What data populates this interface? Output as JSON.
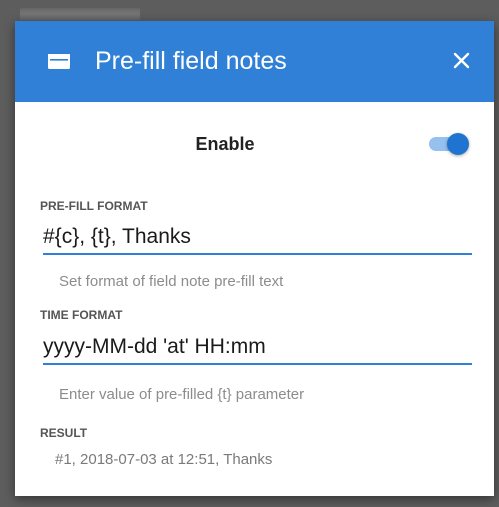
{
  "dialog": {
    "title": "Pre-fill field notes",
    "title_icon": "message-card-icon",
    "close_icon": "close-icon",
    "accent_color": "#2f80d6"
  },
  "enable": {
    "label": "Enable",
    "toggle_on": true
  },
  "prefill_format": {
    "label": "PRE-FILL FORMAT",
    "value": "#{c}, {t}, Thanks",
    "helper": "Set format of field note pre-fill text"
  },
  "time_format": {
    "label": "TIME FORMAT",
    "value": "yyyy-MM-dd 'at' HH:mm",
    "helper": "Enter value of pre-filled {t} parameter"
  },
  "result": {
    "label": "RESULT",
    "value": "#1, 2018-07-03 at 12:51, Thanks"
  }
}
